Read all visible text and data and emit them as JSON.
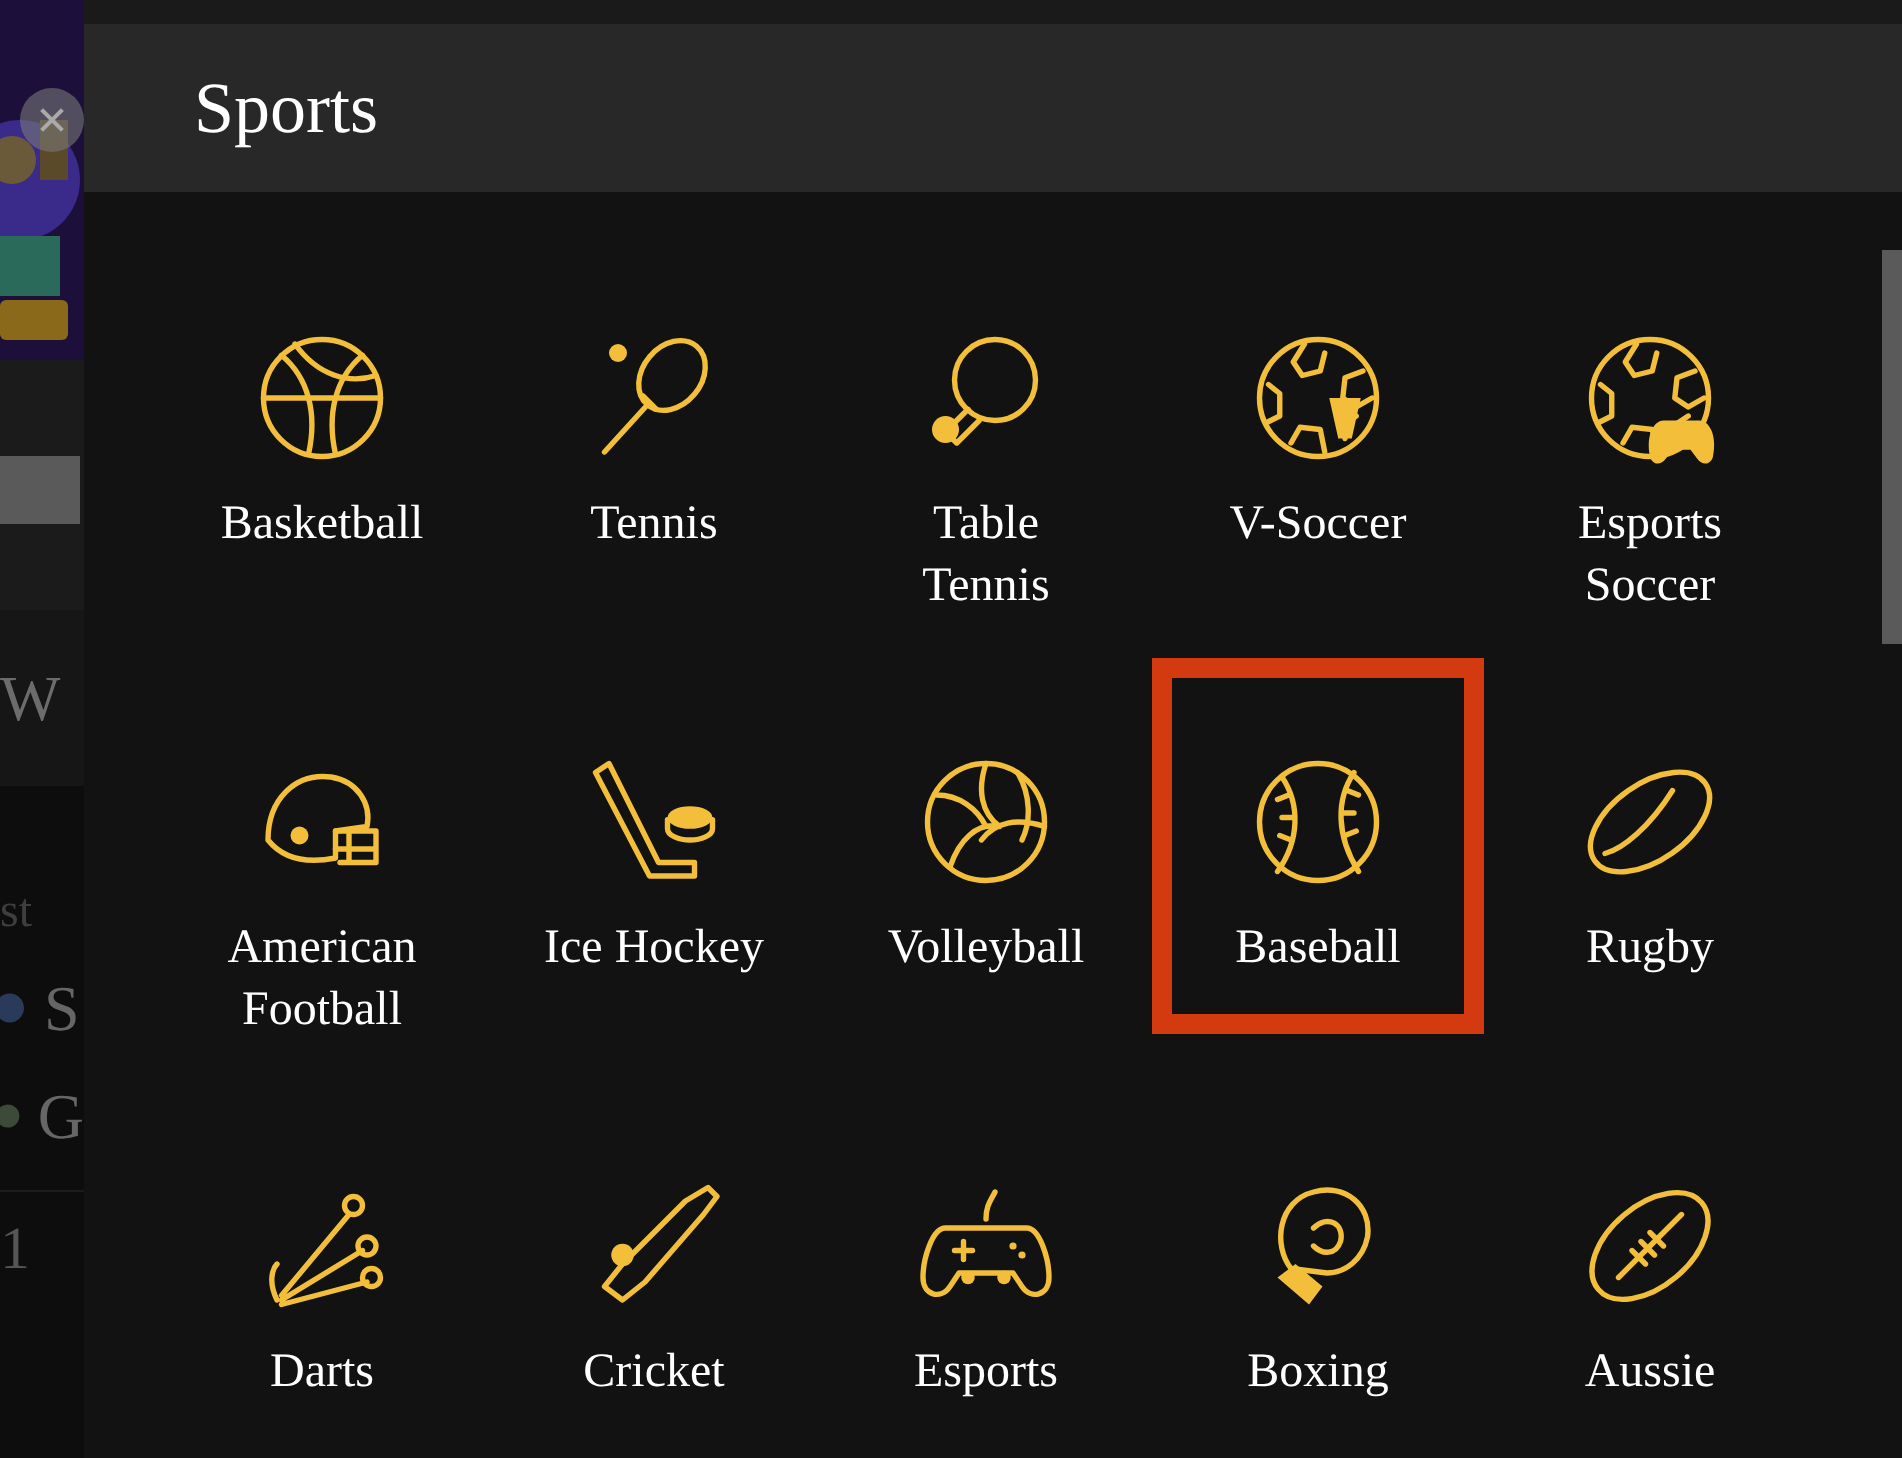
{
  "title": "Sports",
  "sports": [
    {
      "label": "Basketball",
      "selected": false
    },
    {
      "label": "Tennis",
      "selected": false
    },
    {
      "label": "Table Tennis",
      "selected": false
    },
    {
      "label": "V-Soccer",
      "selected": false
    },
    {
      "label": "Esports Soccer",
      "selected": false
    },
    {
      "label": "American Football",
      "selected": false
    },
    {
      "label": "Ice Hockey",
      "selected": false
    },
    {
      "label": "Volleyball",
      "selected": false
    },
    {
      "label": "Baseball",
      "selected": true
    },
    {
      "label": "Rugby",
      "selected": false
    },
    {
      "label": "Darts",
      "selected": false
    },
    {
      "label": "Cricket",
      "selected": false
    },
    {
      "label": "Esports",
      "selected": false
    },
    {
      "label": "Boxing",
      "selected": false
    },
    {
      "label": "Aussie",
      "selected": false
    }
  ],
  "background": {
    "heading": "W",
    "section": "st",
    "teams": [
      "S",
      "G"
    ],
    "score": "1"
  }
}
